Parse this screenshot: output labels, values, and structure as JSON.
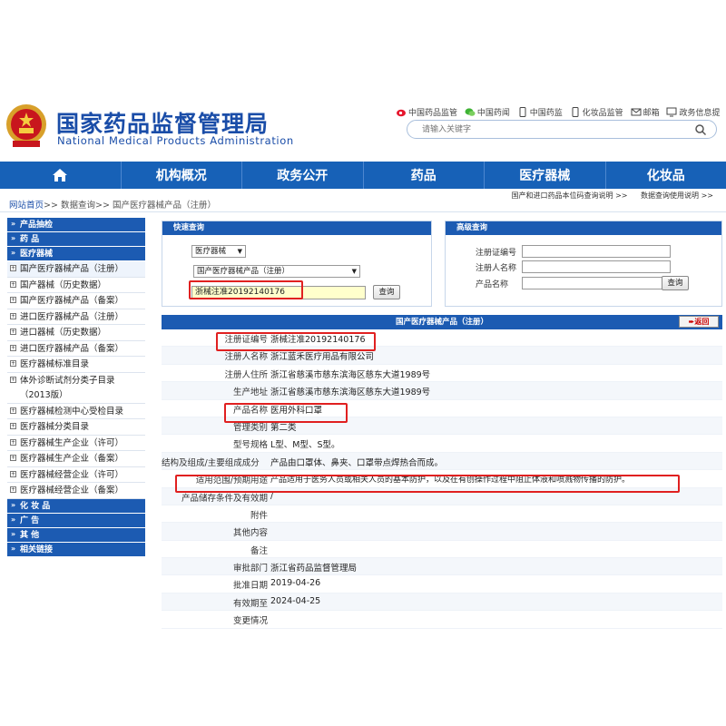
{
  "header": {
    "title": "国家药品监督管理局",
    "subtitle": "National Medical Products Administration",
    "toplinks": [
      {
        "label": "中国药品监管",
        "icon": "weibo-icon"
      },
      {
        "label": "中国药闻",
        "icon": "wechat-icon"
      },
      {
        "label": "中国药监",
        "icon": "mobile-icon"
      },
      {
        "label": "化妆品监管",
        "icon": "mobile-icon"
      },
      {
        "label": "邮箱",
        "icon": "mail-icon"
      },
      {
        "label": "政务信息提",
        "icon": "monitor-icon"
      }
    ],
    "search_placeholder": "请输入关键字"
  },
  "nav": [
    "机构概况",
    "政务公开",
    "药品",
    "医疗器械",
    "化妆品"
  ],
  "breadcrumb": {
    "items": [
      "网站首页",
      "数据查询",
      "国产医疗器械产品（注册）"
    ],
    "sep": ">>"
  },
  "tool_links": [
    "国产和进口药品本位码查询说明 >>",
    "数据查询使用说明 >>"
  ],
  "sidebar": {
    "sections": [
      {
        "title": "产品抽检"
      },
      {
        "title": "药  品"
      },
      {
        "title": "医疗器械"
      }
    ],
    "items": [
      "国产医疗器械产品（注册）",
      "国产器械（历史数据）",
      "国产医疗器械产品（备案）",
      "进口医疗器械产品（注册）",
      "进口器械（历史数据）",
      "进口医疗器械产品（备案）",
      "医疗器械标准目录",
      "体外诊断试剂分类子目录（2013版）",
      "医疗器械检测中心受检目录",
      "医疗器械分类目录",
      "医疗器械生产企业（许可）",
      "医疗器械生产企业（备案）",
      "医疗器械经营企业（许可）",
      "医疗器械经营企业（备案）"
    ],
    "bottom_sections": [
      "化 妆 品",
      "广  告",
      "其  他",
      "相关链接"
    ]
  },
  "quick_query": {
    "title": "快速查询",
    "category": "医疗器械",
    "subcategory": "国产医疗器械产品（注册）",
    "input_value": "浙械注准20192140176",
    "button": "查询"
  },
  "advanced_query": {
    "title": "高级查询",
    "fields": [
      "注册证编号",
      "注册人名称",
      "产品名称"
    ],
    "button": "查询"
  },
  "detail": {
    "title": "国产医疗器械产品（注册）",
    "back_label": "返回",
    "rows": [
      {
        "label": "注册证编号",
        "value": "浙械注准20192140176"
      },
      {
        "label": "注册人名称",
        "value": "浙江蓝禾医疗用品有限公司"
      },
      {
        "label": "注册人住所",
        "value": "浙江省慈溪市慈东滨海区慈东大道1989号"
      },
      {
        "label": "生产地址",
        "value": "浙江省慈溪市慈东滨海区慈东大道1989号"
      },
      {
        "label": "产品名称",
        "value": "医用外科口罩"
      },
      {
        "label": "管理类别",
        "value": "第二类"
      },
      {
        "label": "型号规格",
        "value": "L型、M型、S型。"
      },
      {
        "label": "结构及组成/主要组成成分",
        "value": "产品由口罩体、鼻夹、口罩带点焊热合而成。"
      },
      {
        "label": "适用范围/预期用途",
        "value": "产品适用于医务人员或相关人员的基本防护，以及在有创操作过程中阻止体液和喷溅物传播的防护。"
      },
      {
        "label": "产品储存条件及有效期",
        "value": "/"
      },
      {
        "label": "附件",
        "value": ""
      },
      {
        "label": "其他内容",
        "value": ""
      },
      {
        "label": "备注",
        "value": ""
      },
      {
        "label": "审批部门",
        "value": "浙江省药品监督管理局"
      },
      {
        "label": "批准日期",
        "value": "2019-04-26"
      },
      {
        "label": "有效期至",
        "value": "2024-04-25"
      },
      {
        "label": "变更情况",
        "value": ""
      }
    ]
  },
  "colors": {
    "brand_blue": "#1761b7",
    "panel_blue": "#1c5bb2",
    "highlight_red": "#e02020",
    "input_yellow": "#ffffcc"
  }
}
